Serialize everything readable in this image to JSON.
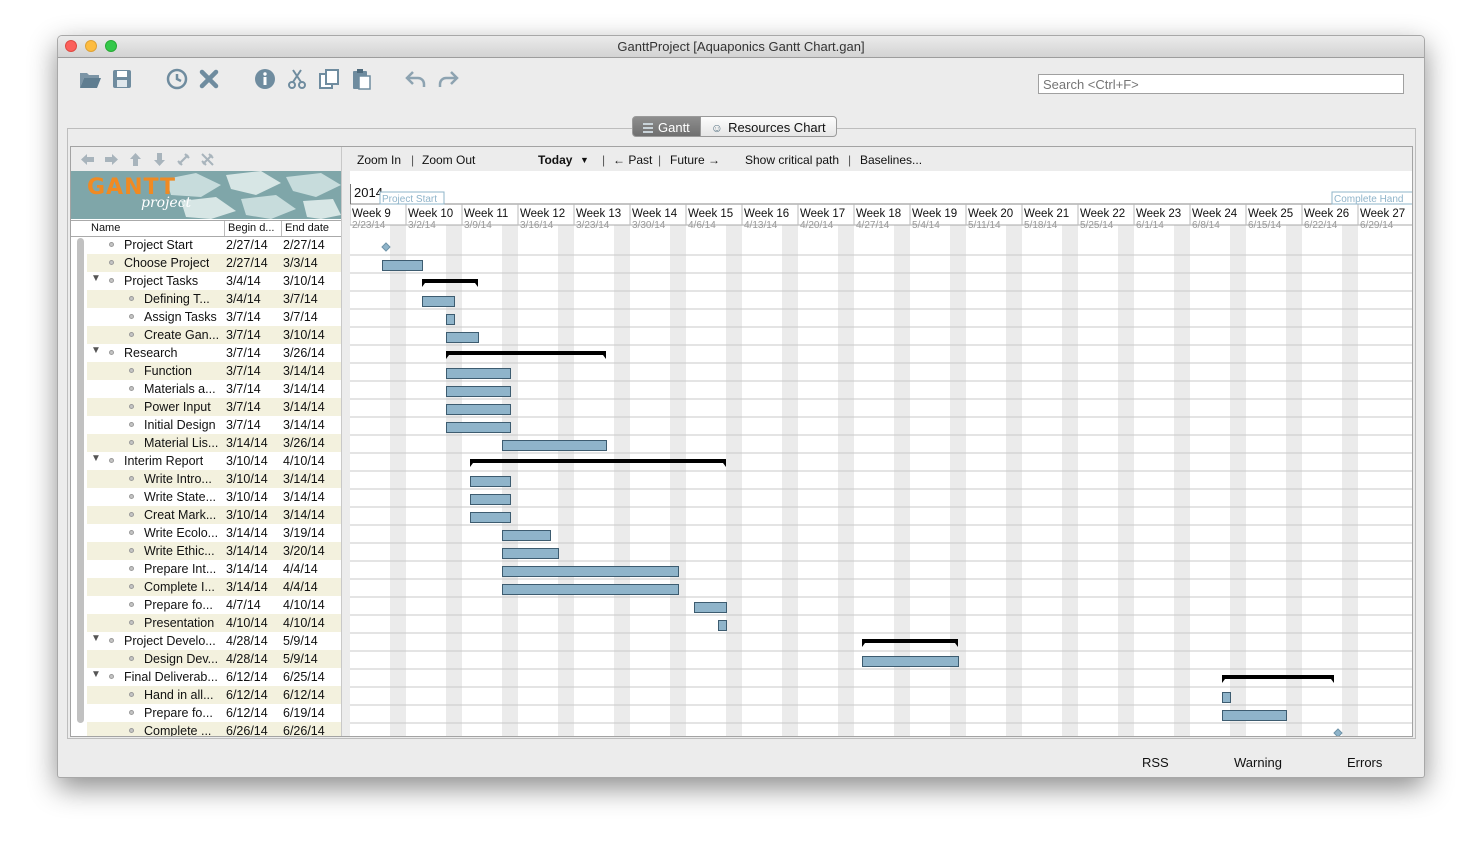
{
  "window": {
    "title": "GanttProject [Aquaponics Gantt Chart.gan]"
  },
  "search": {
    "placeholder": "Search <Ctrl+F>"
  },
  "view_tabs": [
    {
      "label": "Gantt",
      "active": true
    },
    {
      "label": "Resources Chart",
      "active": false
    }
  ],
  "logo": {
    "text": "GANTT",
    "subtext": "project"
  },
  "table_header": {
    "name": "Name",
    "begin": "Begin d...",
    "end": "End date"
  },
  "chart_nav": {
    "zoom_in": "Zoom In",
    "zoom_out": "Zoom Out",
    "today": "Today",
    "past": "← Past",
    "future": "Future →",
    "critical_path": "Show critical path",
    "baselines": "Baselines...",
    "sep": "|"
  },
  "timeline": {
    "year": "2014",
    "weeks": [
      {
        "label": "Week 9",
        "date": "2/23/14"
      },
      {
        "label": "Week 10",
        "date": "3/2/14"
      },
      {
        "label": "Week 11",
        "date": "3/9/14"
      },
      {
        "label": "Week 12",
        "date": "3/16/14"
      },
      {
        "label": "Week 13",
        "date": "3/23/14"
      },
      {
        "label": "Week 14",
        "date": "3/30/14"
      },
      {
        "label": "Week 15",
        "date": "4/6/14"
      },
      {
        "label": "Week 16",
        "date": "4/13/14"
      },
      {
        "label": "Week 17",
        "date": "4/20/14"
      },
      {
        "label": "Week 18",
        "date": "4/27/14"
      },
      {
        "label": "Week 19",
        "date": "5/4/14"
      },
      {
        "label": "Week 20",
        "date": "5/11/14"
      },
      {
        "label": "Week 21",
        "date": "5/18/14"
      },
      {
        "label": "Week 22",
        "date": "5/25/14"
      },
      {
        "label": "Week 23",
        "date": "6/1/14"
      },
      {
        "label": "Week 24",
        "date": "6/8/14"
      },
      {
        "label": "Week 25",
        "date": "6/15/14"
      },
      {
        "label": "Week 26",
        "date": "6/22/14"
      },
      {
        "label": "Week 27",
        "date": "6/29/14"
      }
    ],
    "flags": [
      {
        "label": "Project Start"
      },
      {
        "label": "Complete Hand"
      }
    ]
  },
  "tasks": [
    {
      "name": "Project Start",
      "begin": "2/27/14",
      "end": "2/27/14",
      "level": 0,
      "type": "milestone"
    },
    {
      "name": "Choose Project",
      "begin": "2/27/14",
      "end": "3/3/14",
      "level": 0,
      "type": "task"
    },
    {
      "name": "Project Tasks",
      "begin": "3/4/14",
      "end": "3/10/14",
      "level": 0,
      "type": "group"
    },
    {
      "name": "Defining T...",
      "begin": "3/4/14",
      "end": "3/7/14",
      "level": 1,
      "type": "task"
    },
    {
      "name": "Assign Tasks",
      "begin": "3/7/14",
      "end": "3/7/14",
      "level": 1,
      "type": "task"
    },
    {
      "name": "Create Gan...",
      "begin": "3/7/14",
      "end": "3/10/14",
      "level": 1,
      "type": "task"
    },
    {
      "name": "Research",
      "begin": "3/7/14",
      "end": "3/26/14",
      "level": 0,
      "type": "group"
    },
    {
      "name": "Function",
      "begin": "3/7/14",
      "end": "3/14/14",
      "level": 1,
      "type": "task"
    },
    {
      "name": "Materials a...",
      "begin": "3/7/14",
      "end": "3/14/14",
      "level": 1,
      "type": "task"
    },
    {
      "name": "Power Input",
      "begin": "3/7/14",
      "end": "3/14/14",
      "level": 1,
      "type": "task"
    },
    {
      "name": "Initial Design",
      "begin": "3/7/14",
      "end": "3/14/14",
      "level": 1,
      "type": "task"
    },
    {
      "name": "Material Lis...",
      "begin": "3/14/14",
      "end": "3/26/14",
      "level": 1,
      "type": "task"
    },
    {
      "name": "Interim Report",
      "begin": "3/10/14",
      "end": "4/10/14",
      "level": 0,
      "type": "group"
    },
    {
      "name": "Write Intro...",
      "begin": "3/10/14",
      "end": "3/14/14",
      "level": 1,
      "type": "task"
    },
    {
      "name": "Write State...",
      "begin": "3/10/14",
      "end": "3/14/14",
      "level": 1,
      "type": "task"
    },
    {
      "name": "Creat Mark...",
      "begin": "3/10/14",
      "end": "3/14/14",
      "level": 1,
      "type": "task"
    },
    {
      "name": "Write Ecolo...",
      "begin": "3/14/14",
      "end": "3/19/14",
      "level": 1,
      "type": "task"
    },
    {
      "name": "Write Ethic...",
      "begin": "3/14/14",
      "end": "3/20/14",
      "level": 1,
      "type": "task"
    },
    {
      "name": "Prepare Int...",
      "begin": "3/14/14",
      "end": "4/4/14",
      "level": 1,
      "type": "task"
    },
    {
      "name": "Complete I...",
      "begin": "3/14/14",
      "end": "4/4/14",
      "level": 1,
      "type": "task"
    },
    {
      "name": "Prepare fo...",
      "begin": "4/7/14",
      "end": "4/10/14",
      "level": 1,
      "type": "task"
    },
    {
      "name": "Presentation",
      "begin": "4/10/14",
      "end": "4/10/14",
      "level": 1,
      "type": "task"
    },
    {
      "name": "Project Develo...",
      "begin": "4/28/14",
      "end": "5/9/14",
      "level": 0,
      "type": "group"
    },
    {
      "name": "Design Dev...",
      "begin": "4/28/14",
      "end": "5/9/14",
      "level": 1,
      "type": "task"
    },
    {
      "name": "Final Deliverab...",
      "begin": "6/12/14",
      "end": "6/25/14",
      "level": 0,
      "type": "group"
    },
    {
      "name": "Hand in all...",
      "begin": "6/12/14",
      "end": "6/12/14",
      "level": 1,
      "type": "task"
    },
    {
      "name": "Prepare fo...",
      "begin": "6/12/14",
      "end": "6/19/14",
      "level": 1,
      "type": "task"
    },
    {
      "name": "Complete ...",
      "begin": "6/26/14",
      "end": "6/26/14",
      "level": 1,
      "type": "milestone"
    }
  ],
  "status_bar": {
    "rss": "RSS",
    "warning": "Warning",
    "errors": "Errors"
  },
  "colors": {
    "bar": "#8fb4ca",
    "bar_border": "#3d5c70",
    "group": "#000000",
    "milestone": "#8fb4ca",
    "weekend": "#ebebeb"
  },
  "icons": [
    "open-icon",
    "save-icon",
    "history-icon",
    "delete-icon",
    "info-icon",
    "cut-icon",
    "copy-icon",
    "paste-icon",
    "undo-icon",
    "redo-icon"
  ]
}
